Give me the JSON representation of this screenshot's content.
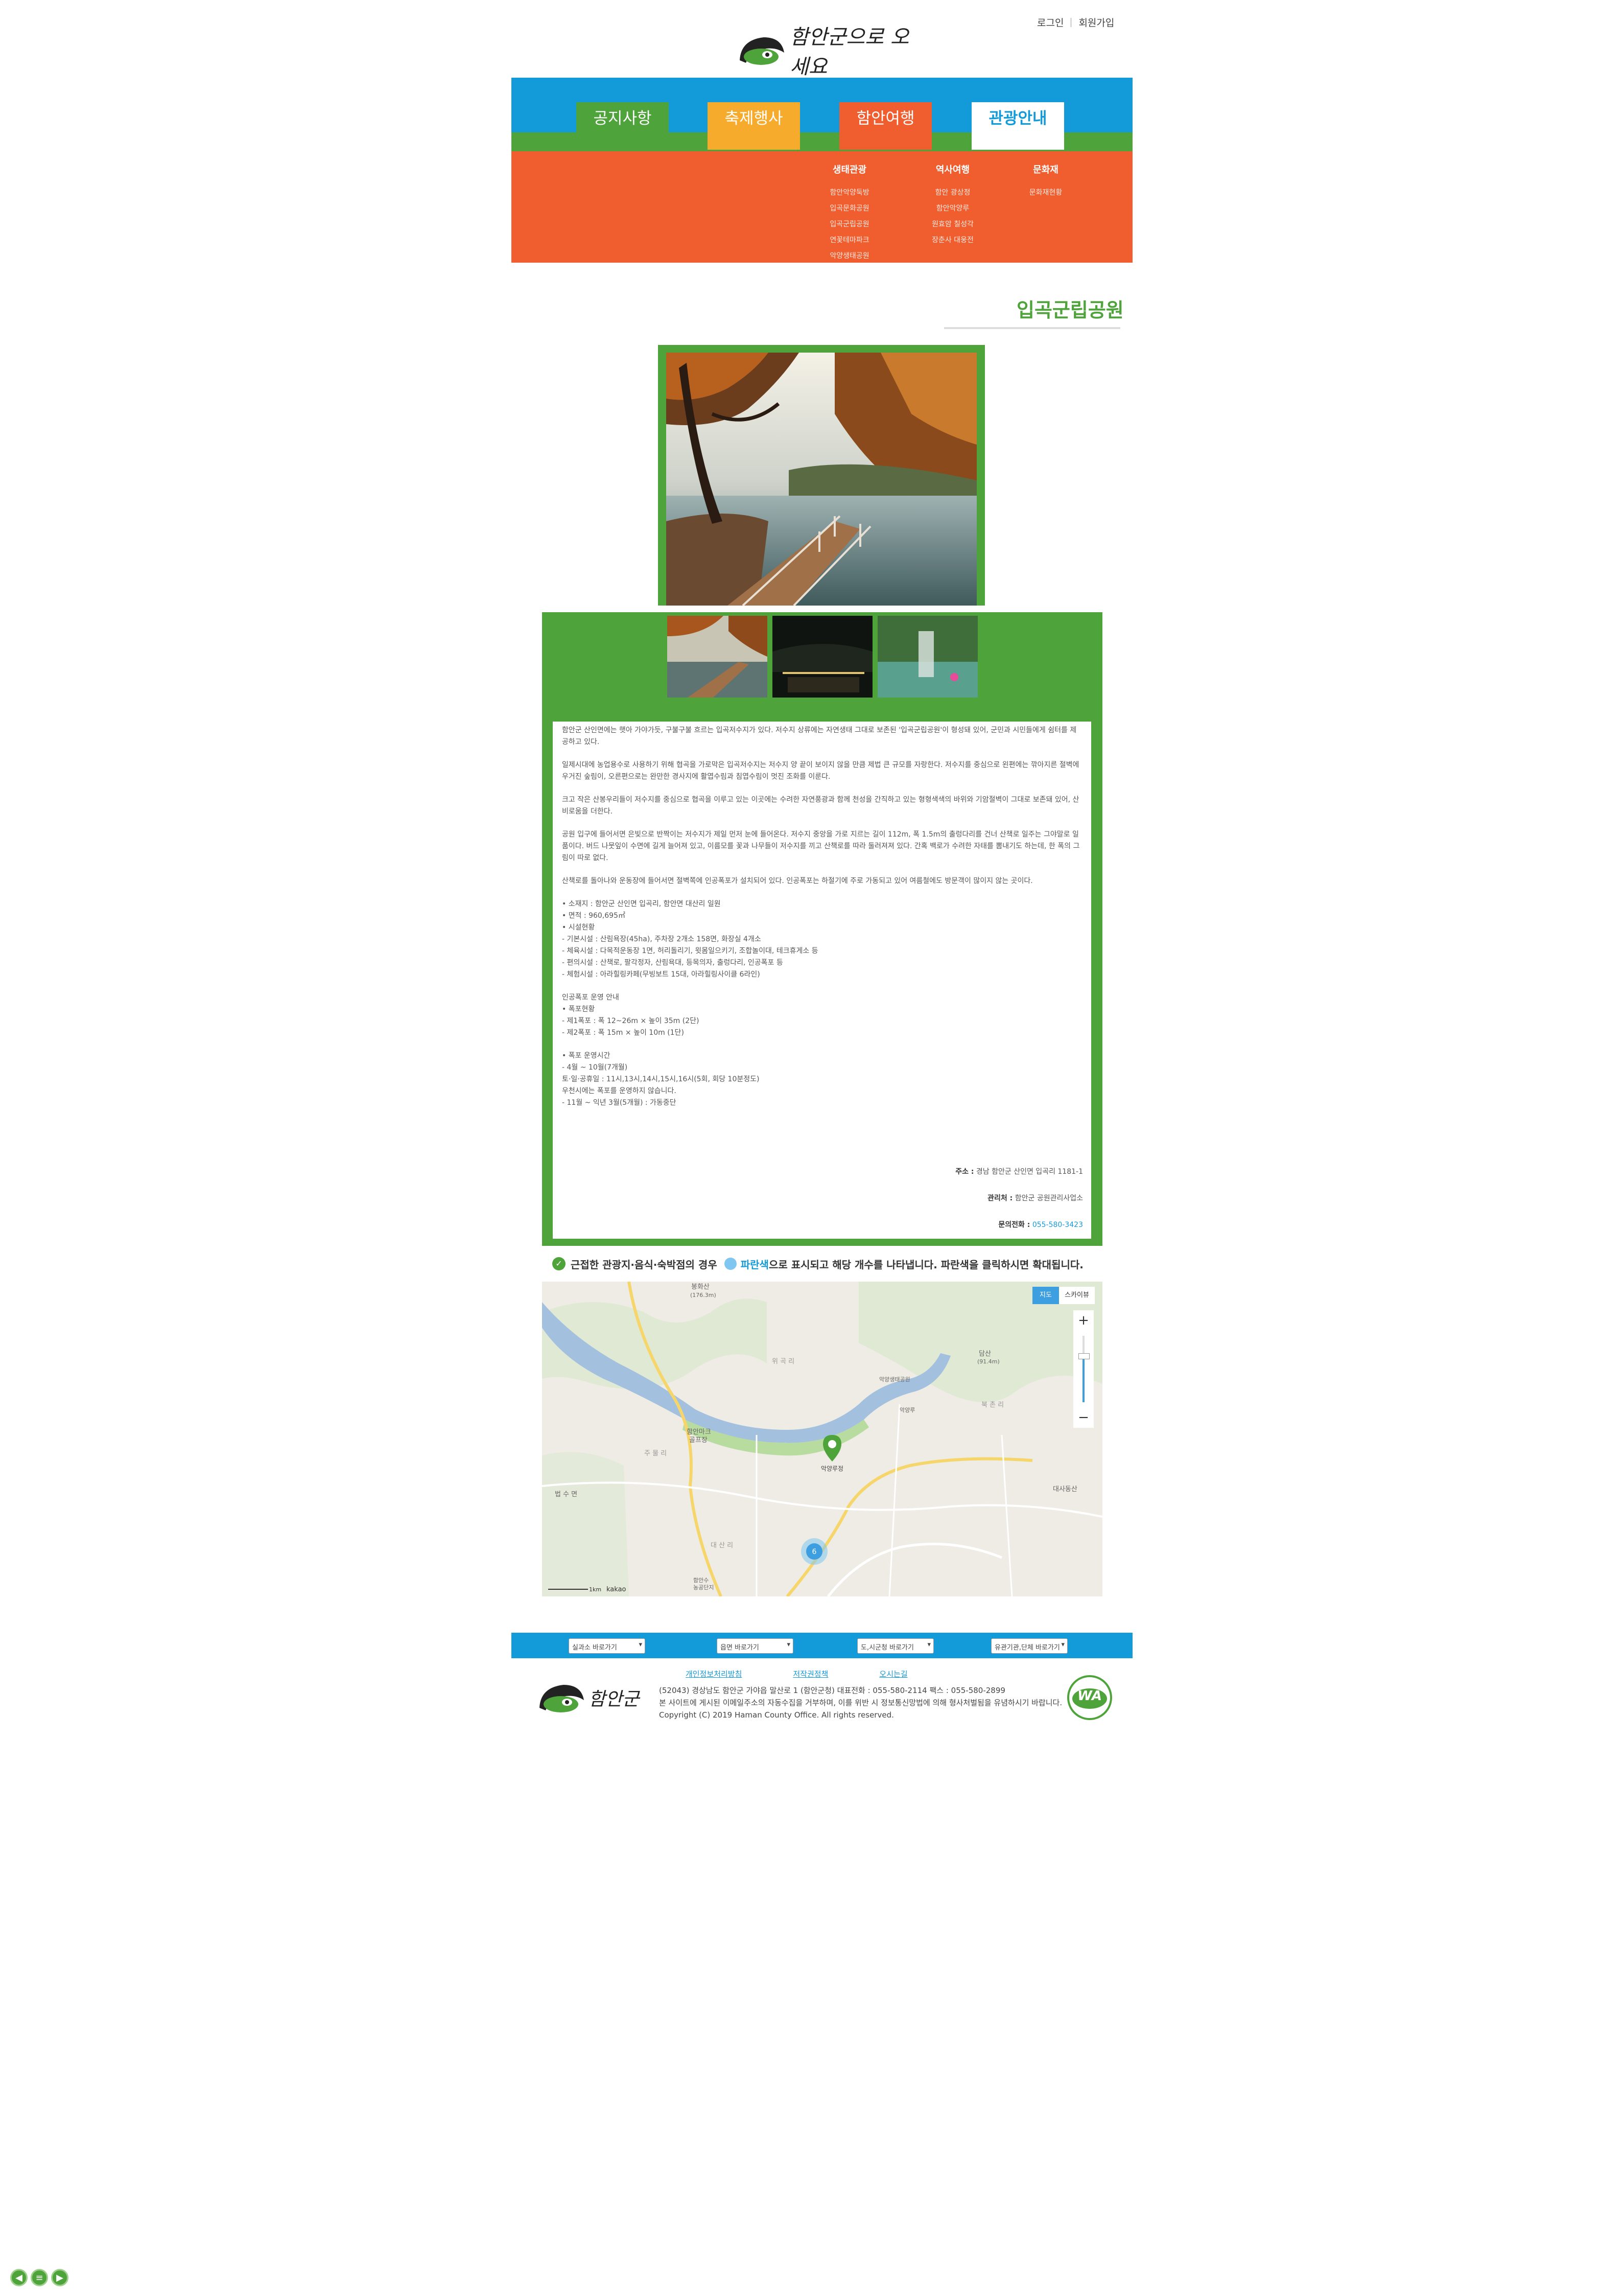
{
  "header": {
    "login": "로그인",
    "join": "회원가입",
    "logo_text": "함안군으로 오세요"
  },
  "nav": {
    "tabs": [
      {
        "label": "공지사항"
      },
      {
        "label": "축제행사"
      },
      {
        "label": "함안여행"
      },
      {
        "label": "관광안내"
      }
    ],
    "columns": [
      {
        "title": "생태관광",
        "items": [
          "함안악양둑방",
          "입곡문화공원",
          "입곡군립공원",
          "연꽃테마파크",
          "악양생태공원"
        ]
      },
      {
        "title": "역사여행",
        "items": [
          "함안 광상정",
          "함안악양루",
          "원효암 칠성각",
          "장춘사 대웅전"
        ]
      },
      {
        "title": "문화재",
        "items": [
          "문화재현황"
        ]
      }
    ]
  },
  "page": {
    "title": "입곡군립공원"
  },
  "content": {
    "paragraphs": [
      "함안군 산인면에는 햇아 가야가듯, 구불구불 흐르는 입곡저수지가 있다. 저수지 상류에는 자연생태 그대로 보존된 '입곡군립공원'이 형성돼 있어, 군민과 시민들에게 쉼터를 제공하고 있다.",
      "일제시대에 농업용수로 사용하기 위해 협곡을 가로막은 입곡저수지는 저수지 양 끝이 보이지 않을 만큼 제법 큰 규모를 자랑한다. 저수지를 중심으로 왼편에는 깎아지른 절벽에 우거진 숲림이, 오른편으로는 완만한 경사지에 활엽수림과 침엽수림이 멋진 조화를 이룬다.",
      "크고 작은 산봉우리들이 저수지를 중심으로 협곡을 이루고 있는 이곳에는 수려한 자연풍광과 함께 천성을 간직하고 있는 형형색색의 바위와 기암절벽이 그대로 보존돼 있어, 산비로움을 더한다.",
      "공원 입구에 들어서면 은빛으로 반짝이는 저수지가 제일 먼저 눈에 들어온다. 저수지 중앙을 가로 지르는 길이 112m, 폭 1.5m의 출렁다리를 건너 산책로 일주는 그야말로 일품이다. 버드 나뭇잎이 수면에 길게 늘어져 있고, 이름모를 꽃과 나무들이 저수지를 끼고 산책로를 따라 둘러져져 있다. 간혹 백로가 수려한 자태를 뽐내기도 하는데, 한 폭의 그림이 따로 없다.",
      "산책로를 돌아나와 운동장에 들어서면 절벽쪽에 인공폭포가 설치되어 있다. 인공폭포는 하절기에 주로 가동되고 있어 여름철에도 방문객이 많이지 않는 곳이다.",
      "• 소재지 : 함안군 산인면 입곡리, 함안면 대산리 일원\n• 면적 : 960,695㎡\n• 시설현황\n- 기본시설 : 산림욕장(45ha), 주차장 2개소 158면, 화장실 4개소\n- 체육시설 : 다목적운동장 1면, 허리돌리기, 윗몸일으키기, 조합놀이대, 테크휴게소 등\n- 편의시설 : 산책로, 팔각정자, 산림욕대, 등목의자, 출렁다리, 인공폭포 등\n- 체험시설 : 아라힐링카페(무빙보트 15대, 아라힐링사이클 6라인)",
      "인공폭포 운영 안내\n• 폭포현황\n- 제1폭포 : 폭 12~26m × 높이 35m (2단)\n- 제2폭포 : 폭 15m × 높이 10m (1단)",
      "• 폭포 운영시간\n- 4월 ~ 10월(7개월)\n 토·일·공휴일 : 11시,13시,14시,15시,16시(5회, 회당 10분정도)\n 우천시에는 폭포를 운영하지 않습니다.\n- 11월 ~ 익년 3월(5개월) : 가동중단"
    ],
    "address_label": "주소 :",
    "address": "경남 함안군 산인면 입곡리 1181-1",
    "manager_label": "관리처 :",
    "manager": "함안군 공원관리사업소",
    "phone_label": "문의전화 :",
    "phone": "055-580-3423"
  },
  "map": {
    "notice_prefix": "근접한 관광지·음식·숙박점의 경우",
    "notice_highlight": "파란색",
    "notice_suffix": "으로 표시되고 해당 개수를 나타냅니다. 파란색을 클릭하시면 확대됩니다.",
    "btn_map": "지도",
    "btn_sky": "스카이뷰",
    "zoom_in": "+",
    "zoom_out": "−",
    "cluster_count": "6",
    "marker_label": "악양루정",
    "scale": "1km",
    "brand": "kakao",
    "labels": [
      "봉화산",
      "(176.3m)",
      "함안마크",
      "골프장",
      "법 수 면",
      "대사동산",
      "담산",
      "(91.4m)",
      "악양생태공원",
      "악양루",
      "함안수",
      "농공단지",
      "위 곡 리",
      "북 촌 리",
      "주 물 리",
      "대 산 리"
    ]
  },
  "footer": {
    "selects": [
      "실과소 바로가기",
      "읍면 바로가기",
      "도,시군청 바로가기",
      "유관기관,단체 바로가기"
    ],
    "links": [
      "개인정보처리방침",
      "저작권정책",
      "오시는길"
    ],
    "address": "(52043) 경상남도 함안군 가야읍 말산로 1 (함안군청)   대표전화 : 055-580-2114   팩스 : 055-580-2899",
    "notice": "본 사이트에 게시된 이메일주소의 자동수집을 거부하며, 이를 위반 시 정보통신망법에 의해 형사처벌됨을 유념하시기 바랍니다.",
    "copyright": "Copyright (C) 2019 Haman County Office. All rights reserved.",
    "logo_text": "함안군",
    "wa_text": "WA"
  },
  "colors": {
    "blue": "#139ad9",
    "green": "#4ea33a",
    "orange": "#f05d2e",
    "yellow": "#f7ab2c"
  }
}
